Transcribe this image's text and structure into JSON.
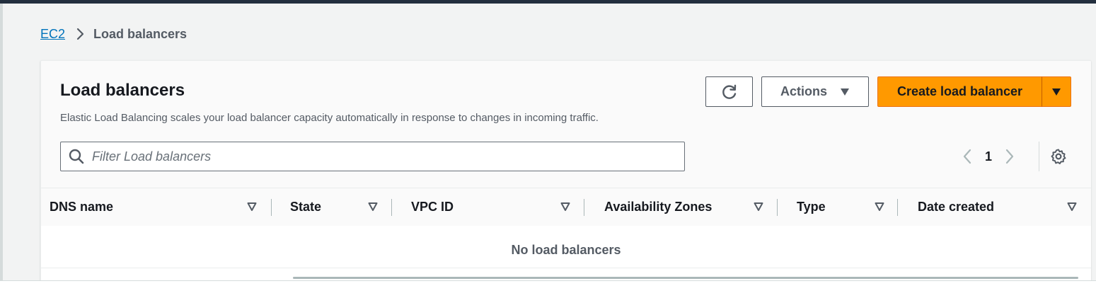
{
  "breadcrumb": {
    "root": "EC2",
    "current": "Load balancers"
  },
  "panel": {
    "title": "Load balancers",
    "description": "Elastic Load Balancing scales your load balancer capacity automatically in response to changes in incoming traffic."
  },
  "toolbar": {
    "refresh_icon": "refresh-icon",
    "actions_label": "Actions",
    "create_label": "Create load balancer",
    "dropdown_icon": "caret-down-icon"
  },
  "search": {
    "placeholder": "Filter Load balancers",
    "value": ""
  },
  "pagination": {
    "current_page": "1"
  },
  "table": {
    "columns": [
      "DNS name",
      "State",
      "VPC ID",
      "Availability Zones",
      "Type",
      "Date created"
    ],
    "empty_message": "No load balancers"
  },
  "colors": {
    "primary_button": "#ff9900",
    "link": "#0073bb",
    "header_bar": "#232f3e"
  }
}
